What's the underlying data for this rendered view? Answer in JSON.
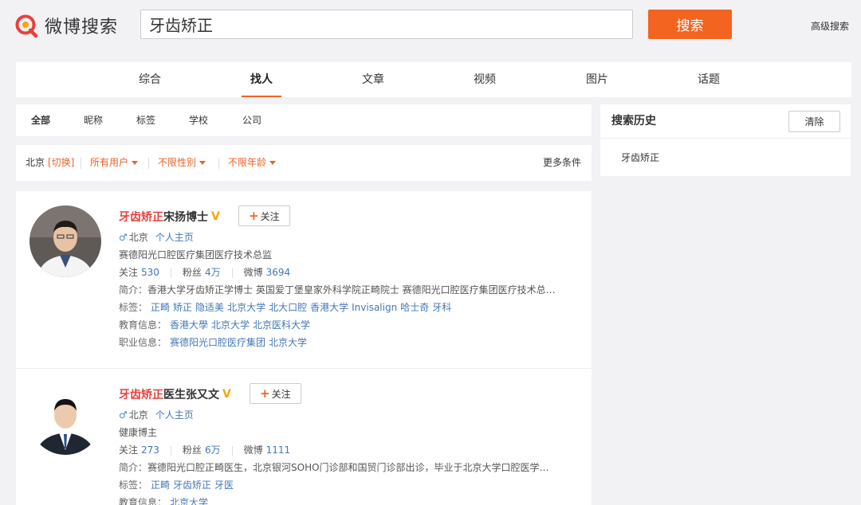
{
  "header": {
    "logo_text": "微博搜索",
    "search_value": "牙齿矫正",
    "search_button": "搜索",
    "advanced_search": "高级搜索"
  },
  "tabs": [
    {
      "label": "综合"
    },
    {
      "label": "找人",
      "active": true
    },
    {
      "label": "文章"
    },
    {
      "label": "视频"
    },
    {
      "label": "图片"
    },
    {
      "label": "话题"
    }
  ],
  "subtabs": [
    {
      "label": "全部",
      "active": true
    },
    {
      "label": "昵称"
    },
    {
      "label": "标签"
    },
    {
      "label": "学校"
    },
    {
      "label": "公司"
    }
  ],
  "filters": {
    "location": "北京",
    "switch": "[切换]",
    "users": "所有用户",
    "gender": "不限性别",
    "age": "不限年龄",
    "more": "更多条件"
  },
  "results": [
    {
      "name_highlight": "牙齿矫正",
      "name_rest": "宋扬博士",
      "follow": "关注",
      "location": "北京",
      "homepage": "个人主页",
      "title": "赛德阳光口腔医疗集团医疗技术总监",
      "following_label": "关注",
      "following": "530",
      "fans_label": "粉丝",
      "fans": "4万",
      "weibo_label": "微博",
      "weibo": "3694",
      "intro_label": "简介：",
      "intro": "香港大学牙齿矫正学博士 英国爱丁堡皇家外科学院正畸院士 赛德阳光口腔医疗集团医疗技术总…",
      "tags_label": "标签：",
      "tags": [
        "正畸",
        "矫正",
        "隐适美",
        "北京大学",
        "北大口腔",
        "香港大学",
        "Invisalign",
        "哈士奇",
        "牙科"
      ],
      "edu_label": "教育信息：",
      "edu": [
        "香港大學",
        "北京大学",
        "北京医科大学"
      ],
      "job_label": "职业信息：",
      "job": [
        "赛德阳光口腔医疗集团",
        "北京大学"
      ]
    },
    {
      "name_highlight": "牙齿矫正",
      "name_rest": "医生张又文",
      "follow": "关注",
      "location": "北京",
      "homepage": "个人主页",
      "title": "健康博主",
      "following_label": "关注",
      "following": "273",
      "fans_label": "粉丝",
      "fans": "6万",
      "weibo_label": "微博",
      "weibo": "1111",
      "intro_label": "简介：",
      "intro": "赛德阳光口腔正畸医生，北京银河SOHO门诊部和国贸门诊部出诊，毕业于北京大学口腔医学…",
      "tags_label": "标签：",
      "tags": [
        "正畸",
        "牙齿矫正",
        "牙医"
      ],
      "edu_label": "教育信息：",
      "edu": [
        "北京大学"
      ]
    }
  ],
  "sidebar": {
    "title": "搜索历史",
    "clear": "清除",
    "history": [
      "牙齿矫正"
    ]
  },
  "colors": {
    "accent": "#f26420",
    "highlight": "#e8403e",
    "link": "#4377b7",
    "verified": "#f3a700"
  }
}
